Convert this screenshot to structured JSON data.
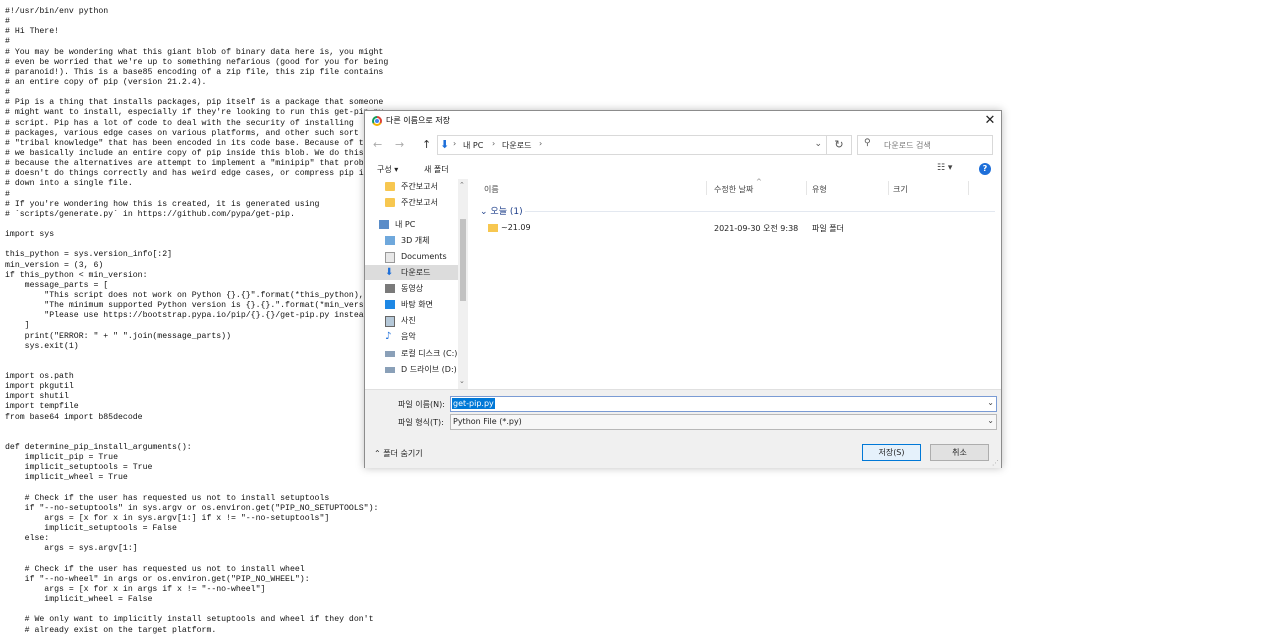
{
  "source_lines": [
    "#!/usr/bin/env python",
    "#",
    "# Hi There!",
    "#",
    "# You may be wondering what this giant blob of binary data here is, you might",
    "# even be worried that we're up to something nefarious (good for you for being",
    "# paranoid!). This is a base85 encoding of a zip file, this zip file contains",
    "# an entire copy of pip (version 21.2.4).",
    "#",
    "# Pip is a thing that installs packages, pip itself is a package that someone",
    "# might want to install, especially if they're looking to run this get-pip.py",
    "# script. Pip has a lot of code to deal with the security of installing",
    "# packages, various edge cases on various platforms, and other such sort of",
    "# \"tribal knowledge\" that has been encoded in its code base. Because of this",
    "# we basically include an entire copy of pip inside this blob. We do this",
    "# because the alternatives are attempt to implement a \"minipip\" that probably",
    "# doesn't do things correctly and has weird edge cases, or compress pip itself",
    "# down into a single file.",
    "#",
    "# If you're wondering how this is created, it is generated using",
    "# `scripts/generate.py` in https://github.com/pypa/get-pip.",
    "",
    "import sys",
    "",
    "this_python = sys.version_info[:2]",
    "min_version = (3, 6)",
    "if this_python < min_version:",
    "    message_parts = [",
    "        \"This script does not work on Python {}.{}\".format(*this_python),",
    "        \"The minimum supported Python version is {}.{}.\".format(*min_version),",
    "        \"Please use https://bootstrap.pypa.io/pip/{}.{}/get-pip.py instead.\".format(*this_python),",
    "    ]",
    "    print(\"ERROR: \" + \" \".join(message_parts))",
    "    sys.exit(1)",
    "",
    "",
    "import os.path",
    "import pkgutil",
    "import shutil",
    "import tempfile",
    "from base64 import b85decode",
    "",
    "",
    "def determine_pip_install_arguments():",
    "    implicit_pip = True",
    "    implicit_setuptools = True",
    "    implicit_wheel = True",
    "",
    "    # Check if the user has requested us not to install setuptools",
    "    if \"--no-setuptools\" in sys.argv or os.environ.get(\"PIP_NO_SETUPTOOLS\"):",
    "        args = [x for x in sys.argv[1:] if x != \"--no-setuptools\"]",
    "        implicit_setuptools = False",
    "    else:",
    "        args = sys.argv[1:]",
    "",
    "    # Check if the user has requested us not to install wheel",
    "    if \"--no-wheel\" in args or os.environ.get(\"PIP_NO_WHEEL\"):",
    "        args = [x for x in args if x != \"--no-wheel\"]",
    "        implicit_wheel = False",
    "",
    "    # We only want to implicitly install setuptools and wheel if they don't",
    "    # already exist on the target platform."
  ],
  "dialog": {
    "title": "다른 이름으로 저장",
    "close": "✕",
    "nav": {
      "back": "←",
      "forward": "→",
      "up": "↑",
      "sep": "›",
      "path_pc": "내 PC",
      "path_folder": "다운로드",
      "dropdown": "⌄",
      "refresh": "↻",
      "search_placeholder": "다운로드 검색"
    },
    "toolbar": {
      "organize": "구성 ▾",
      "new_folder": "새 폴더",
      "view": "☷ ▾",
      "help": "?"
    },
    "nav_pane": [
      {
        "label": "주간보고서",
        "icon": "folder-icon",
        "kind": "folder"
      },
      {
        "label": "주간보고서",
        "icon": "folder-icon",
        "kind": "folder"
      },
      {
        "label": "내 PC",
        "icon": "computer-icon",
        "kind": "pc"
      },
      {
        "label": "3D 개체",
        "icon": "cube-icon",
        "kind": "3d"
      },
      {
        "label": "Documents",
        "icon": "document-icon",
        "kind": "doc"
      },
      {
        "label": "다운로드",
        "icon": "download-icon",
        "kind": "down",
        "selected": true
      },
      {
        "label": "동영상",
        "icon": "video-icon",
        "kind": "video"
      },
      {
        "label": "바탕 화면",
        "icon": "desktop-icon",
        "kind": "desktop"
      },
      {
        "label": "사진",
        "icon": "picture-icon",
        "kind": "pic"
      },
      {
        "label": "음악",
        "icon": "music-icon",
        "kind": "music"
      },
      {
        "label": "로컬 디스크 (C:)",
        "icon": "drive-icon",
        "kind": "drive"
      },
      {
        "label": "D 드라이브 (D:)",
        "icon": "drive-icon",
        "kind": "drive"
      }
    ],
    "columns": {
      "name": "이름",
      "date": "수정한 날짜",
      "type": "유형",
      "size": "크기",
      "sort_indicator": "^"
    },
    "group": {
      "label": "오늘 (1)",
      "chevron": "⌄"
    },
    "files": [
      {
        "name": "~21.09",
        "date": "2021-09-30 오전 9:38",
        "type": "파일 폴더",
        "size": ""
      }
    ],
    "filename_label": "파일 이름(N):",
    "filename_value": "get-pip.py",
    "filetype_label": "파일 형식(T):",
    "filetype_value": "Python File (*.py)",
    "hide_folders": "⌃ 폴더 숨기기",
    "save": "저장(S)",
    "cancel": "취소",
    "scroll_up": "⌃",
    "scroll_down": "⌄"
  },
  "colors": {
    "accent": "#0078d7",
    "folder": "#f7c750",
    "selected_bg": "#dcdcdc"
  }
}
